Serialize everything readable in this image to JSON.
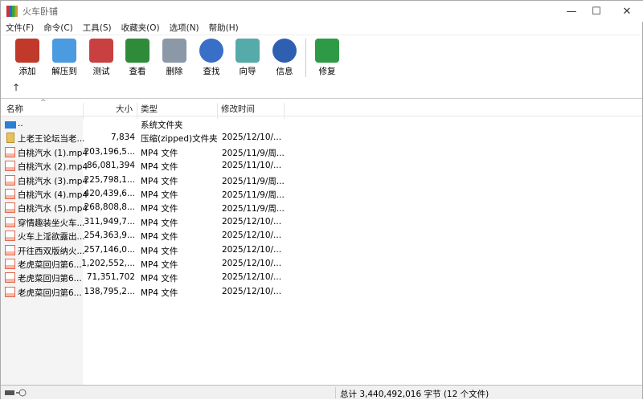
{
  "window": {
    "title": "火车卧铺",
    "minimize": "—",
    "maximize": "☐",
    "close": "✕"
  },
  "menu": [
    "文件(F)",
    "命令(C)",
    "工具(S)",
    "收藏夹(O)",
    "选项(N)",
    "帮助(H)"
  ],
  "toolbar": [
    {
      "label": "添加",
      "icon": "add-archive-icon",
      "color": "#c0392b"
    },
    {
      "label": "解压到",
      "icon": "extract-folder-icon",
      "color": "#4a9be0"
    },
    {
      "label": "测试",
      "icon": "test-clipboard-icon",
      "color": "#c94040"
    },
    {
      "label": "查看",
      "icon": "view-book-icon",
      "color": "#2e8b3a"
    },
    {
      "label": "删除",
      "icon": "trash-icon",
      "color": "#8a98a8"
    },
    {
      "label": "查找",
      "icon": "search-magnifier-icon",
      "color": "#3a6fc7"
    },
    {
      "label": "向导",
      "icon": "wizard-wand-icon",
      "color": "#5aa"
    },
    {
      "label": "信息",
      "icon": "info-icon",
      "color": "#2f5fb0"
    },
    {
      "label": "修复",
      "icon": "repair-icon",
      "color": "#2e9a45"
    }
  ],
  "up_arrow": "↑",
  "columns": {
    "name": "名称",
    "size": "大小",
    "type": "类型",
    "date": "修改时间",
    "sort": "^"
  },
  "files": [
    {
      "name": "..",
      "size": "",
      "type": "系统文件夹",
      "date": "",
      "icon": "folder-up-icon"
    },
    {
      "name": "上老王论坛当老...",
      "size": "7,834",
      "type": "压缩(zipped)文件夹",
      "date": "2025/12/10/...",
      "icon": "zip-icon"
    },
    {
      "name": "白桃汽水 (1).mp4",
      "size": "203,196,5...",
      "type": "MP4 文件",
      "date": "2025/11/9/周...",
      "icon": "mp4-icon"
    },
    {
      "name": "白桃汽水 (2).mp4",
      "size": "86,081,394",
      "type": "MP4 文件",
      "date": "2025/11/10/...",
      "icon": "mp4-icon"
    },
    {
      "name": "白桃汽水 (3).mp4",
      "size": "225,798,1...",
      "type": "MP4 文件",
      "date": "2025/11/9/周...",
      "icon": "mp4-icon"
    },
    {
      "name": "白桃汽水 (4).mp4",
      "size": "420,439,6...",
      "type": "MP4 文件",
      "date": "2025/11/9/周...",
      "icon": "mp4-icon"
    },
    {
      "name": "白桃汽水 (5).mp4",
      "size": "268,808,8...",
      "type": "MP4 文件",
      "date": "2025/11/9/周...",
      "icon": "mp4-icon"
    },
    {
      "name": "穿情趣装坐火车...",
      "size": "311,949,7...",
      "type": "MP4 文件",
      "date": "2025/12/10/...",
      "icon": "mp4-icon"
    },
    {
      "name": "火车上淫欲露出...",
      "size": "254,363,9...",
      "type": "MP4 文件",
      "date": "2025/12/10/...",
      "icon": "mp4-icon"
    },
    {
      "name": "开往西双版纳火...",
      "size": "257,146,0...",
      "type": "MP4 文件",
      "date": "2025/12/10/...",
      "icon": "mp4-icon"
    },
    {
      "name": "老虎菜回归第6...",
      "size": "1,202,552,...",
      "type": "MP4 文件",
      "date": "2025/12/10/...",
      "icon": "mp4-icon"
    },
    {
      "name": "老虎菜回归第6...",
      "size": "71,351,702",
      "type": "MP4 文件",
      "date": "2025/12/10/...",
      "icon": "mp4-icon"
    },
    {
      "name": "老虎菜回归第6...",
      "size": "138,795,2...",
      "type": "MP4 文件",
      "date": "2025/12/10/...",
      "icon": "mp4-icon"
    }
  ],
  "status": {
    "total": "总计 3,440,492,016 字节 (12 个文件)"
  }
}
